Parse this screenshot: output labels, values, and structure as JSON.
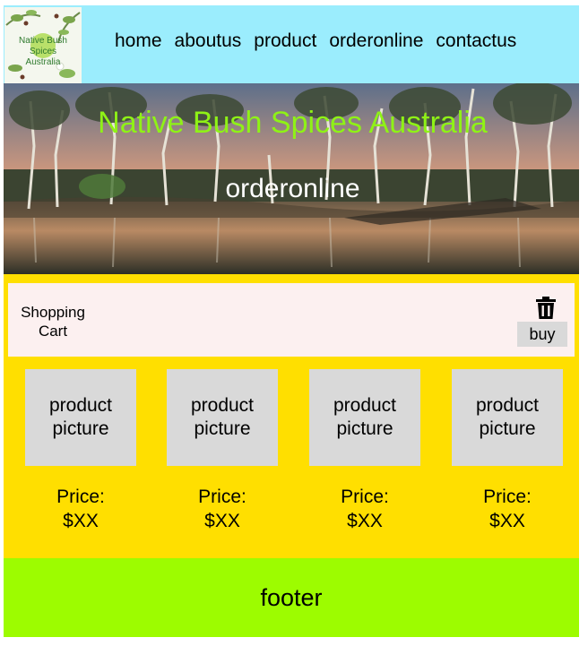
{
  "header": {
    "logo_text": [
      "Native Bush Spices",
      "Australia"
    ],
    "nav": [
      "home",
      "aboutus",
      "product",
      "orderonline",
      "contactus"
    ]
  },
  "hero": {
    "title": "Native Bush Spices Australia",
    "subtitle": "orderonline"
  },
  "cart": {
    "title": "Shopping Cart",
    "delete_icon": "trash-icon",
    "buy_label": "buy"
  },
  "products": [
    {
      "picture_label": "product picture",
      "price_label": "Price:",
      "price": "$XX"
    },
    {
      "picture_label": "product picture",
      "price_label": "Price:",
      "price": "$XX"
    },
    {
      "picture_label": "product picture",
      "price_label": "Price:",
      "price": "$XX"
    },
    {
      "picture_label": "product picture",
      "price_label": "Price:",
      "price": "$XX"
    }
  ],
  "footer": {
    "text": "footer"
  },
  "colors": {
    "header_bg": "#9bedfd",
    "hero_title": "#8ff216",
    "shop_band": "#ffdf00",
    "cart_bar": "#fcf0f0",
    "placeholder_gray": "#d9d9d9",
    "footer_bg": "#9dfc00"
  }
}
